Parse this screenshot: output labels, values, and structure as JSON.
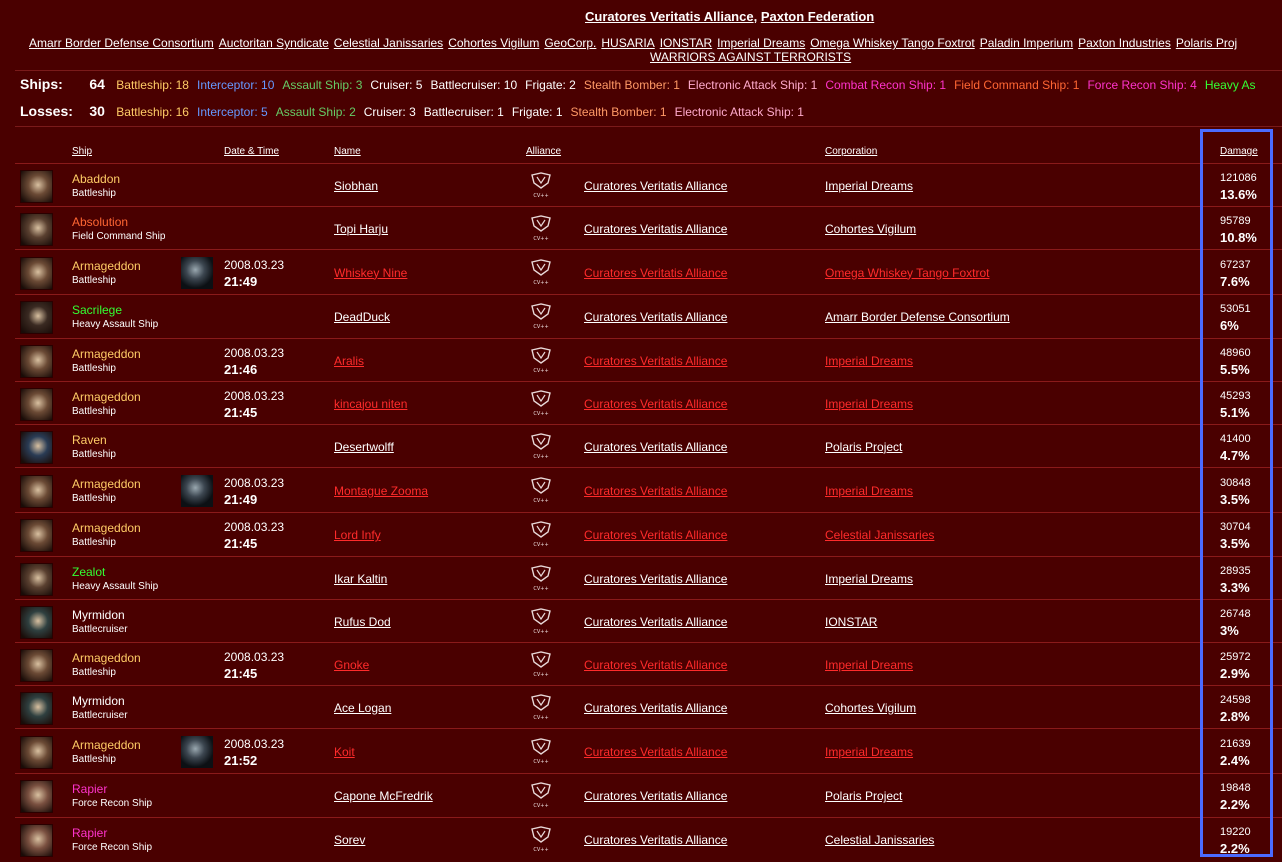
{
  "header": {
    "sides": [
      "Curatores Veritatis Alliance",
      "Paxton Federation"
    ],
    "separator": ", ",
    "corporations": [
      "Amarr Border Defense Consortium",
      "Auctoritan Syndicate",
      "Celestial Janissaries",
      "Cohortes Vigilum",
      "GeoCorp.",
      "HUSARIA",
      "IONSTAR",
      "Imperial Dreams",
      "Omega Whiskey Tango Foxtrot",
      "Paladin Imperium",
      "Paxton Industries",
      "Polaris Proj"
    ],
    "corporations_line2": "WARRIORS AGAINST TERRORISTS"
  },
  "ships_summary": {
    "label": "Ships:",
    "count": "64",
    "categories": [
      {
        "text": "Battleship: 18",
        "color": "#ffcc66"
      },
      {
        "text": "Interceptor: 10",
        "color": "#6699ff"
      },
      {
        "text": "Assault Ship: 3",
        "color": "#66cc66"
      },
      {
        "text": "Cruiser: 5",
        "color": "#ffffff"
      },
      {
        "text": "Battlecruiser: 10",
        "color": "#ffffff"
      },
      {
        "text": "Frigate: 2",
        "color": "#ffffff"
      },
      {
        "text": "Stealth Bomber: 1",
        "color": "#ff9966"
      },
      {
        "text": "Electronic Attack Ship: 1",
        "color": "#ffaacc"
      },
      {
        "text": "Combat Recon Ship: 1",
        "color": "#ff33cc"
      },
      {
        "text": "Field Command Ship: 1",
        "color": "#ff6633"
      },
      {
        "text": "Force Recon Ship: 4",
        "color": "#ff33cc"
      },
      {
        "text": "Heavy As",
        "color": "#33ff33"
      }
    ]
  },
  "losses_summary": {
    "label": "Losses:",
    "count": "30",
    "categories": [
      {
        "text": "Battleship: 16",
        "color": "#ffcc66"
      },
      {
        "text": "Interceptor: 5",
        "color": "#6699ff"
      },
      {
        "text": "Assault Ship: 2",
        "color": "#66cc66"
      },
      {
        "text": "Cruiser: 3",
        "color": "#ffffff"
      },
      {
        "text": "Battlecruiser: 1",
        "color": "#ffffff"
      },
      {
        "text": "Frigate: 1",
        "color": "#ffffff"
      },
      {
        "text": "Stealth Bomber: 1",
        "color": "#ff9966"
      },
      {
        "text": "Electronic Attack Ship: 1",
        "color": "#ffaacc"
      }
    ]
  },
  "table": {
    "headers": {
      "ship": "Ship",
      "datetime": "Date & Time",
      "name": "Name",
      "alliance": "Alliance",
      "corporation": "Corporation",
      "damage": "Damage"
    },
    "alliance_logo_icon": "cva-alliance-logo-icon",
    "rows": [
      {
        "ship": "Abaddon",
        "class": "Battleship",
        "ship_color": "#ffcc66",
        "thumb": "#6b4a35",
        "date": "",
        "time": "",
        "lost": false,
        "name": "Siobhan",
        "alliance": "Curatores Veritatis Alliance",
        "corp": "Imperial Dreams",
        "damage": "121086",
        "pct": "13.6%"
      },
      {
        "ship": "Absolution",
        "class": "Field Command Ship",
        "ship_color": "#ff6633",
        "thumb": "#5a4030",
        "date": "",
        "time": "",
        "lost": false,
        "name": "Topi Harju",
        "alliance": "Curatores Veritatis Alliance",
        "corp": "Cohortes Vigilum",
        "damage": "95789",
        "pct": "10.8%"
      },
      {
        "ship": "Armageddon",
        "class": "Battleship",
        "ship_color": "#ffcc66",
        "thumb": "#6b4a35",
        "date": "2008.03.23",
        "time": "21:49",
        "lost": true,
        "name": "Whiskey Nine",
        "alliance": "Curatores Veritatis Alliance",
        "corp": "Omega Whiskey Tango Foxtrot",
        "damage": "67237",
        "pct": "7.6%"
      },
      {
        "ship": "Sacrilege",
        "class": "Heavy Assault Ship",
        "ship_color": "#33ff33",
        "thumb": "#3a2a22",
        "date": "",
        "time": "",
        "lost": false,
        "name": "DeadDuck",
        "alliance": "Curatores Veritatis Alliance",
        "corp": "Amarr Border Defense Consortium",
        "damage": "53051",
        "pct": "6%"
      },
      {
        "ship": "Armageddon",
        "class": "Battleship",
        "ship_color": "#ffcc66",
        "thumb": "#6b4a35",
        "date": "2008.03.23",
        "time": "21:46",
        "lost": false,
        "name": "Aralis",
        "alliance": "Curatores Veritatis Alliance",
        "corp": "Imperial Dreams",
        "damage": "48960",
        "pct": "5.5%"
      },
      {
        "ship": "Armageddon",
        "class": "Battleship",
        "ship_color": "#ffcc66",
        "thumb": "#6b4a35",
        "date": "2008.03.23",
        "time": "21:45",
        "lost": false,
        "name": "kincajou niten",
        "alliance": "Curatores Veritatis Alliance",
        "corp": "Imperial Dreams",
        "damage": "45293",
        "pct": "5.1%"
      },
      {
        "ship": "Raven",
        "class": "Battleship",
        "ship_color": "#ffcc66",
        "thumb": "#2a3c55",
        "date": "",
        "time": "",
        "lost": false,
        "name": "Desertwolff",
        "alliance": "Curatores Veritatis Alliance",
        "corp": "Polaris Project",
        "damage": "41400",
        "pct": "4.7%"
      },
      {
        "ship": "Armageddon",
        "class": "Battleship",
        "ship_color": "#ffcc66",
        "thumb": "#6b4a35",
        "date": "2008.03.23",
        "time": "21:49",
        "lost": true,
        "name": "Montague Zooma",
        "alliance": "Curatores Veritatis Alliance",
        "corp": "Imperial Dreams",
        "damage": "30848",
        "pct": "3.5%"
      },
      {
        "ship": "Armageddon",
        "class": "Battleship",
        "ship_color": "#ffcc66",
        "thumb": "#6b4a35",
        "date": "2008.03.23",
        "time": "21:45",
        "lost": false,
        "name": "Lord Infy",
        "alliance": "Curatores Veritatis Alliance",
        "corp": "Celestial Janissaries",
        "damage": "30704",
        "pct": "3.5%"
      },
      {
        "ship": "Zealot",
        "class": "Heavy Assault Ship",
        "ship_color": "#33ff33",
        "thumb": "#5a4030",
        "date": "",
        "time": "",
        "lost": false,
        "name": "Ikar Kaltin",
        "alliance": "Curatores Veritatis Alliance",
        "corp": "Imperial Dreams",
        "damage": "28935",
        "pct": "3.3%"
      },
      {
        "ship": "Myrmidon",
        "class": "Battlecruiser",
        "ship_color": "#ffffff",
        "thumb": "#2f4040",
        "date": "",
        "time": "",
        "lost": false,
        "name": "Rufus Dod",
        "alliance": "Curatores Veritatis Alliance",
        "corp": "IONSTAR",
        "damage": "26748",
        "pct": "3%"
      },
      {
        "ship": "Armageddon",
        "class": "Battleship",
        "ship_color": "#ffcc66",
        "thumb": "#6b4a35",
        "date": "2008.03.23",
        "time": "21:45",
        "lost": false,
        "name": "Gnoke",
        "alliance": "Curatores Veritatis Alliance",
        "corp": "Imperial Dreams",
        "damage": "25972",
        "pct": "2.9%"
      },
      {
        "ship": "Myrmidon",
        "class": "Battlecruiser",
        "ship_color": "#ffffff",
        "thumb": "#2f4040",
        "date": "",
        "time": "",
        "lost": false,
        "name": "Ace Logan",
        "alliance": "Curatores Veritatis Alliance",
        "corp": "Cohortes Vigilum",
        "damage": "24598",
        "pct": "2.8%"
      },
      {
        "ship": "Armageddon",
        "class": "Battleship",
        "ship_color": "#ffcc66",
        "thumb": "#6b4a35",
        "date": "2008.03.23",
        "time": "21:52",
        "lost": true,
        "name": "Koit",
        "alliance": "Curatores Veritatis Alliance",
        "corp": "Imperial Dreams",
        "damage": "21639",
        "pct": "2.4%"
      },
      {
        "ship": "Rapier",
        "class": "Force Recon Ship",
        "ship_color": "#ff33cc",
        "thumb": "#7a5040",
        "date": "",
        "time": "",
        "lost": false,
        "name": "Capone McFredrik",
        "alliance": "Curatores Veritatis Alliance",
        "corp": "Polaris Project",
        "damage": "19848",
        "pct": "2.2%"
      },
      {
        "ship": "Rapier",
        "class": "Force Recon Ship",
        "ship_color": "#ff33cc",
        "thumb": "#7a5040",
        "date": "",
        "time": "",
        "lost": false,
        "name": "Sorev",
        "alliance": "Curatores Veritatis Alliance",
        "corp": "Celestial Janissaries",
        "damage": "19220",
        "pct": "2.2%"
      }
    ]
  },
  "colors": {
    "background": "#4a0000",
    "row_border": "#8a1a1a",
    "lost_link": "#ff2b2b",
    "highlight_box": "#4b6bff"
  }
}
